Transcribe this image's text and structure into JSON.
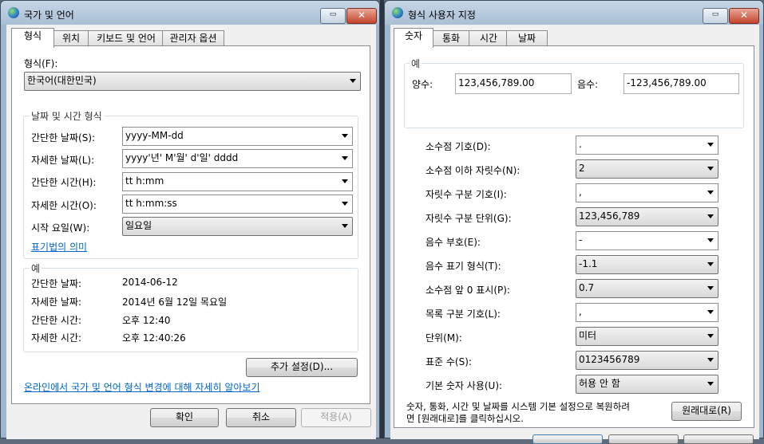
{
  "left_window": {
    "title": "국가 및 언어",
    "tabs": [
      "형식",
      "위치",
      "키보드 및 언어",
      "관리자 옵션"
    ],
    "format_label": "형식(F):",
    "format_value": "한국어(대한민국)",
    "datetime_group": "날짜 및 시간 형식",
    "rows": [
      {
        "label": "간단한 날짜(S):",
        "value": "yyyy-MM-dd"
      },
      {
        "label": "자세한 날짜(L):",
        "value": "yyyy'년' M'월' d'일' dddd"
      },
      {
        "label": "간단한 시간(H):",
        "value": "tt h:mm"
      },
      {
        "label": "자세한 시간(O):",
        "value": "tt h:mm:ss"
      },
      {
        "label": "시작 요일(W):",
        "value": "일요일"
      }
    ],
    "notation_link": "표기법의 의미",
    "example_group": "예",
    "examples": [
      {
        "label": "간단한 날짜:",
        "value": "2014-06-12"
      },
      {
        "label": "자세한 날짜:",
        "value": "2014년 6월 12일 목요일"
      },
      {
        "label": "간단한 시간:",
        "value": "오후 12:40"
      },
      {
        "label": "자세한 시간:",
        "value": "오후 12:40:26"
      }
    ],
    "additional_button": "추가 설정(D)...",
    "online_link": "온라인에서 국가 및 언어 형식 변경에 대해 자세히 알아보기",
    "ok_button": "확인",
    "cancel_button": "취소",
    "apply_button": "적용(A)"
  },
  "right_window": {
    "title": "형식 사용자 지정",
    "tabs": [
      "숫자",
      "통화",
      "시간",
      "날짜"
    ],
    "example_group": "예",
    "positive_label": "양수:",
    "positive_value": "123,456,789.00",
    "negative_label": "음수:",
    "negative_value": "-123,456,789.00",
    "settings": [
      {
        "label": "소수점 기호(D):",
        "value": "."
      },
      {
        "label": "소수점 이하 자릿수(N):",
        "value": "2"
      },
      {
        "label": "자릿수 구분 기호(I):",
        "value": ","
      },
      {
        "label": "자릿수 구분 단위(G):",
        "value": "123,456,789"
      },
      {
        "label": "음수 부호(E):",
        "value": "-"
      },
      {
        "label": "음수 표기 형식(T):",
        "value": "-1.1"
      },
      {
        "label": "소수점 앞 0 표시(P):",
        "value": "0.7"
      },
      {
        "label": "목록 구분 기호(L):",
        "value": ","
      },
      {
        "label": "단위(M):",
        "value": "미터"
      },
      {
        "label": "표준 수(S):",
        "value": "0123456789"
      },
      {
        "label": "기본 숫자 사용(U):",
        "value": "허용 안 함"
      }
    ],
    "reset_text_1": "숫자, 통화, 시간 및 날짜를 시스템 기본 설정으로 복원하려",
    "reset_text_2": "면 [원래대로]를 클릭하십시오.",
    "reset_button": "원래대로(R)"
  },
  "colors": {
    "link": "#0066cc",
    "chrome": "#9fb6cd",
    "close": "#c4432b"
  }
}
